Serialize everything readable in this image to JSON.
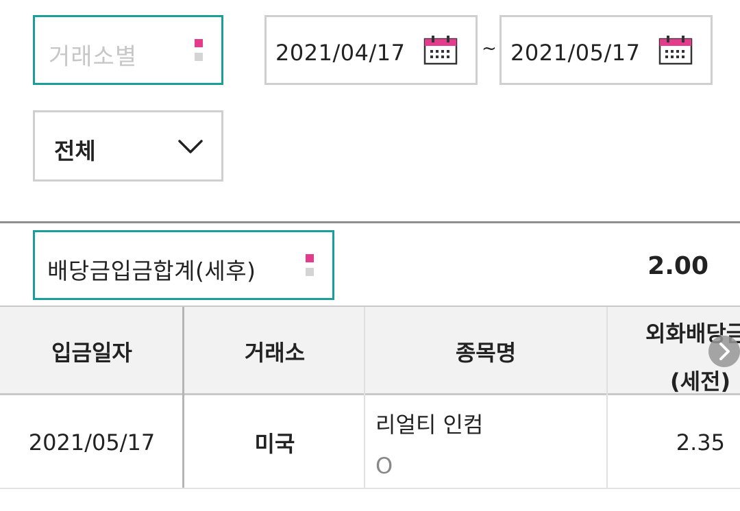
{
  "filters": {
    "exchange_placeholder": "거래소별",
    "date_start": "2021/04/17",
    "date_separator": "~",
    "date_end": "2021/05/17",
    "type_selected": "전체"
  },
  "summary": {
    "label": "배당금입금합계(세후)",
    "value": "2.00"
  },
  "table": {
    "columns": [
      "입금일자",
      "거래소",
      "종목명",
      "외화배당금",
      "(세전)"
    ],
    "rows": [
      {
        "date": "2021/05/17",
        "exchange": "미국",
        "name": "리얼티 인컴",
        "sub": "O",
        "amount": "2.35"
      }
    ]
  },
  "colors": {
    "accent_teal": "#1a9e9a",
    "accent_pink": "#e33c8c",
    "header_bg": "#f2f2f2"
  },
  "icons": [
    "calendar-icon",
    "chevron-down-icon",
    "sort-arrows-icon",
    "chevron-right-icon"
  ]
}
